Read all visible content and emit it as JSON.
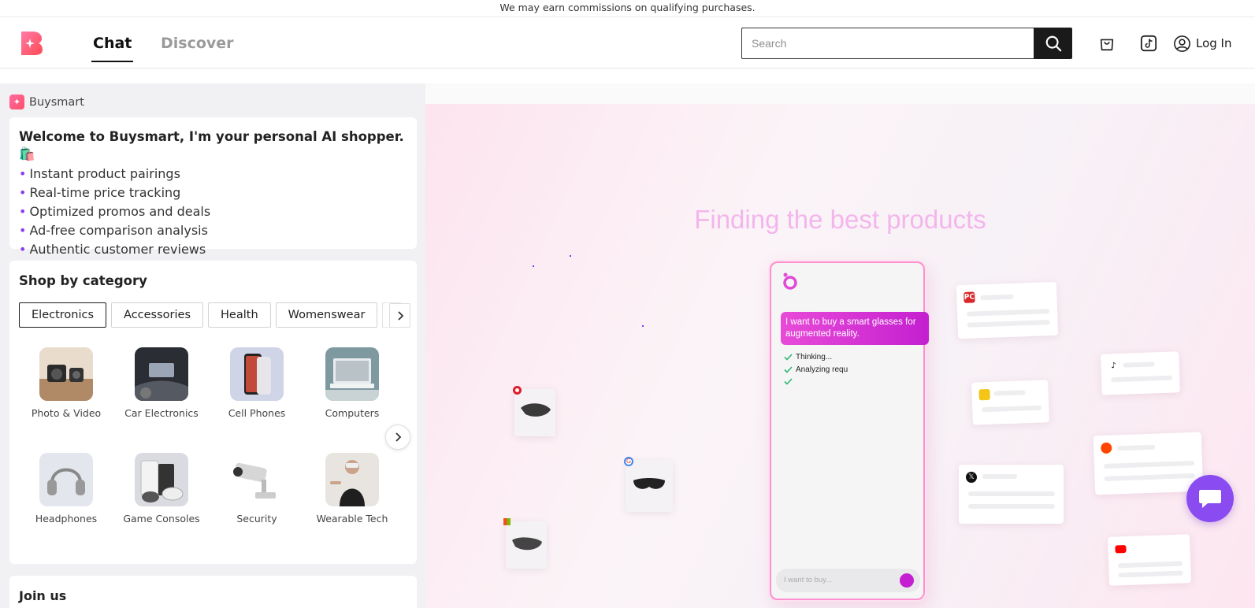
{
  "banner": {
    "text": "We may earn commissions on qualifying purchases."
  },
  "header": {
    "tabs": [
      {
        "label": "Chat",
        "active": true
      },
      {
        "label": "Discover",
        "active": false
      }
    ],
    "search": {
      "placeholder": "Search",
      "value": ""
    },
    "icons": [
      "search-icon",
      "cart-icon",
      "tiktok-icon",
      "user-circle-icon"
    ],
    "login_label": "Log In"
  },
  "sidebar": {
    "brand_name": "Buysmart",
    "welcome": {
      "title": "Welcome to Buysmart, I'm your personal AI shopper. 🛍️",
      "bullets": [
        "Instant product pairings",
        "Real-time price tracking",
        "Optimized promos and deals",
        "Ad-free comparison analysis",
        "Authentic customer reviews"
      ]
    },
    "categories": {
      "title": "Shop by category",
      "chips": [
        "Electronics",
        "Accessories",
        "Health",
        "Womenswear"
      ],
      "selected_chip": "Electronics",
      "items": [
        "Photo & Video",
        "Car Electronics",
        "Cell Phones",
        "Computers",
        "Headphones",
        "Game Consoles",
        "Security",
        "Wearable Tech"
      ]
    },
    "join_title": "Join us"
  },
  "hero": {
    "title": "Finding the best products",
    "phone": {
      "message": "I want to buy a smart glasses for augmented reality.",
      "steps": [
        "Thinking...",
        "Analyzing requ",
        ""
      ],
      "input_placeholder": "I want to buy..."
    },
    "sources": [
      "PC",
      "tiktok-icon",
      "google-meet-icon",
      "reddit-icon",
      "x-icon",
      "youtube-icon",
      "target-icon",
      "google-icon",
      "microsoft-icon"
    ]
  },
  "colors": {
    "accent": "#8a4cf0",
    "brand_pink": "#ff4f6e",
    "bubble": "#c41fd0",
    "hero_title": "#f3b6ec"
  }
}
